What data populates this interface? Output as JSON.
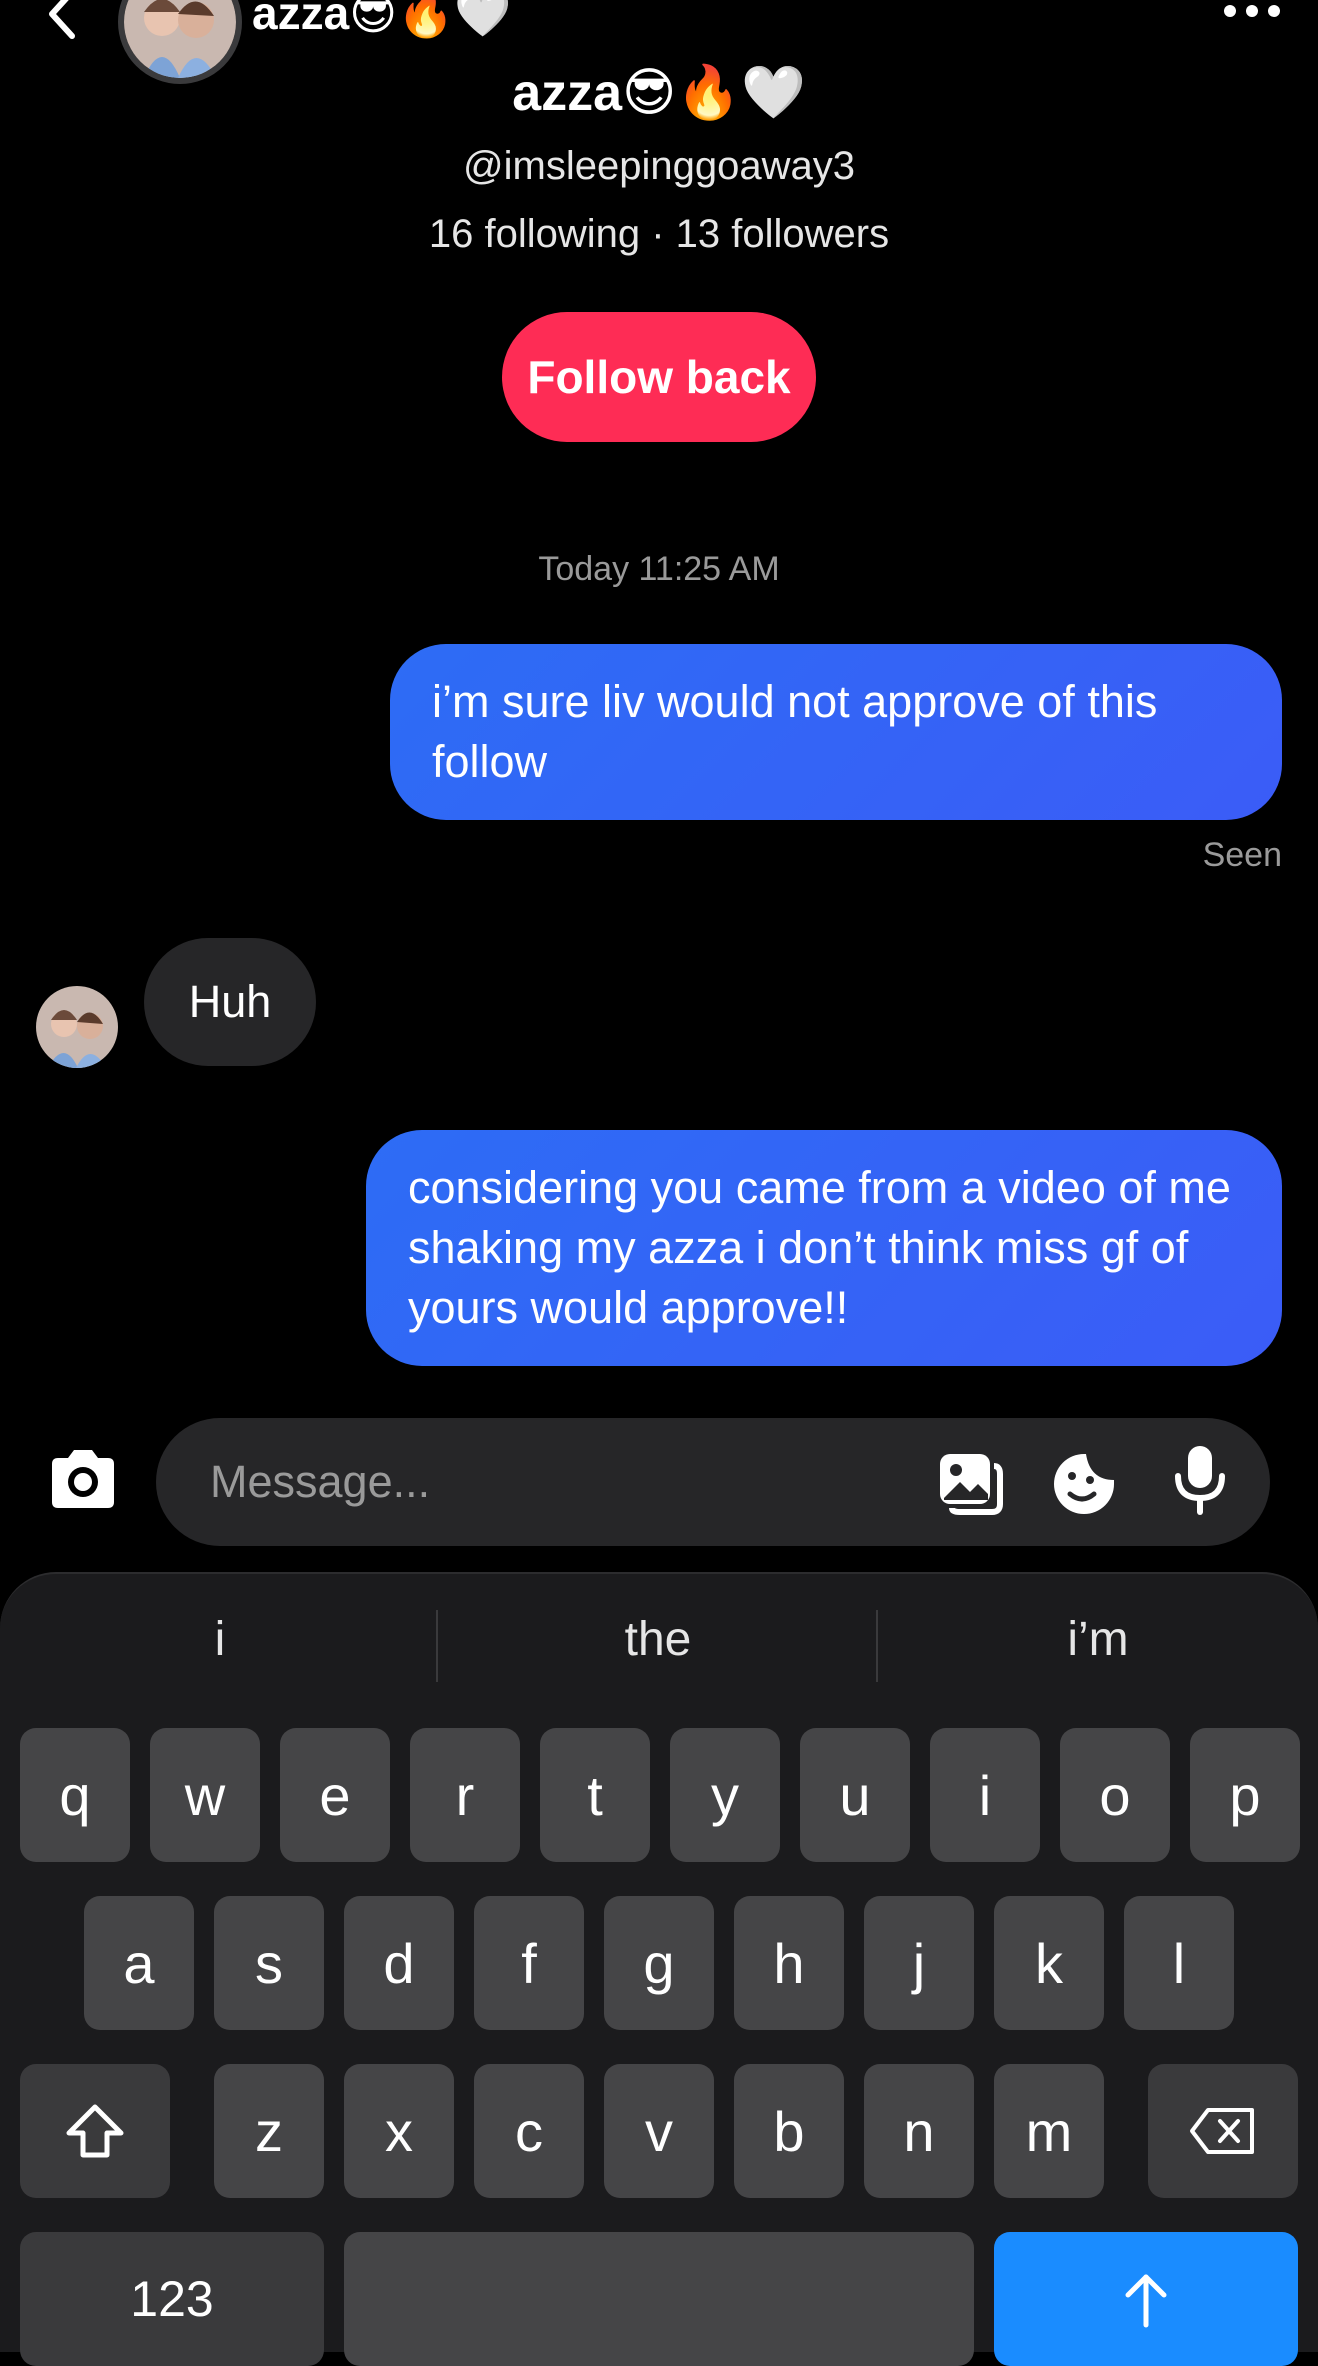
{
  "header": {
    "name": "azza😎🔥🤍",
    "back_icon": "chevron-left-icon",
    "more_icon": "more-horizontal-icon"
  },
  "profile": {
    "name": "azza😎🔥🤍",
    "handle": "@imsleepinggoaway3",
    "stats": "16 following · 13 followers",
    "follow_back_label": "Follow back",
    "follow_color": "#fe2c55"
  },
  "chat": {
    "timestamp": "Today 11:25 AM",
    "messages": [
      {
        "direction": "out",
        "text": "i’m sure liv would not approve of this follow"
      },
      {
        "direction": "in",
        "text": "Huh"
      },
      {
        "direction": "out",
        "text": "considering you came from a video of me shaking my azza i don’t think miss gf of yours would approve!!"
      }
    ],
    "seen_label": "Seen",
    "outgoing_color": "#2d6cf5"
  },
  "composer": {
    "placeholder": "Message...",
    "icons": [
      "camera-icon",
      "gallery-icon",
      "sticker-icon",
      "microphone-icon"
    ]
  },
  "keyboard": {
    "suggestions": [
      "i",
      "the",
      "i’m"
    ],
    "row1": [
      "q",
      "w",
      "e",
      "r",
      "t",
      "y",
      "u",
      "i",
      "o",
      "p"
    ],
    "row2": [
      "a",
      "s",
      "d",
      "f",
      "g",
      "h",
      "j",
      "k",
      "l"
    ],
    "row3": [
      "z",
      "x",
      "c",
      "v",
      "b",
      "n",
      "m"
    ],
    "numbers_label": "123",
    "enter_color": "#1a8cff"
  }
}
